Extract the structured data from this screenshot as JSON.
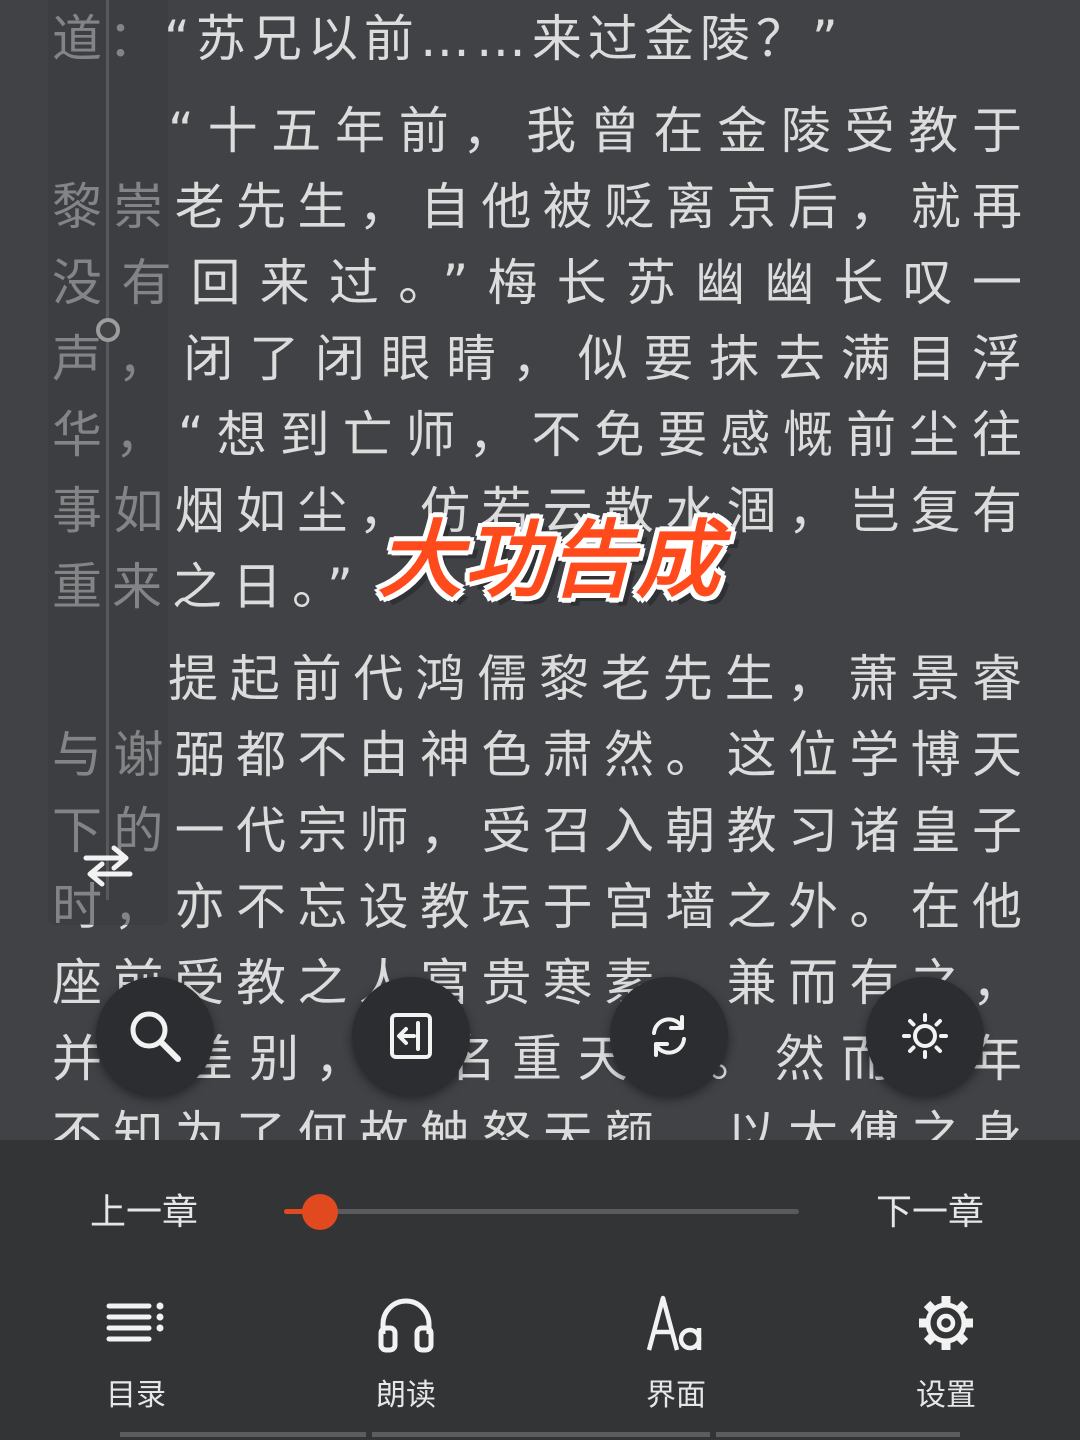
{
  "reader": {
    "lines": [
      "道：“苏兄以前……来过金陵？”",
      "“十五年前，我曾在金陵受教于",
      "黎崇老先生，自他被贬离京后，就再",
      "没有回来过。”梅长苏幽幽长叹一",
      "声，闭了闭眼睛，似要抹去满目浮",
      "华，“想到亡师，不免要感慨前尘往",
      "事如烟如尘，仿若云散水涸，岂复有",
      "重来之日。”",
      "提起前代鸿儒黎老先生，萧景睿",
      "与谢弼都不由神色肃然。这位学博天",
      "下的一代宗师，受召入朝教习诸皇子",
      "时，亦不忘设教坛于宫墙之外。在他",
      "座前受教之人富贵寒素，兼而有之，",
      "并无差别，而名重天下。然而当年",
      "不知为了何故触怒天颜，以太傅之身"
    ]
  },
  "overlay": {
    "title": "大功告成"
  },
  "fabs": [
    {
      "name": "search-button",
      "icon": "search-icon"
    },
    {
      "name": "exit-button",
      "icon": "exit-icon"
    },
    {
      "name": "sync-button",
      "icon": "refresh-icon"
    },
    {
      "name": "brightness-button",
      "icon": "sun-icon"
    }
  ],
  "nav": {
    "prev_label": "上一章",
    "next_label": "下一章",
    "progress_fraction": 0.07
  },
  "tabs": [
    {
      "label": "目录",
      "icon": "list-icon"
    },
    {
      "label": "朗读",
      "icon": "headphones-icon"
    },
    {
      "label": "界面",
      "icon": "font-icon"
    },
    {
      "label": "设置",
      "icon": "gear-icon"
    }
  ],
  "colors": {
    "accent": "#e04a1e",
    "background": "#404246",
    "panel": "#333436",
    "title": "#ff4a1c"
  }
}
